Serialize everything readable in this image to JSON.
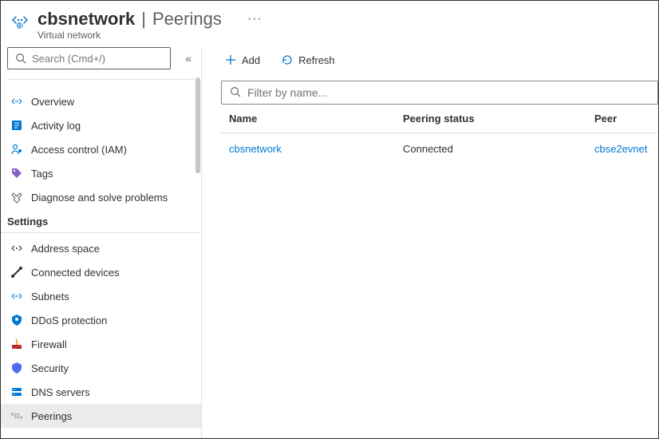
{
  "header": {
    "resource_name": "cbsnetwork",
    "page_name": "Peerings",
    "resource_type": "Virtual network",
    "more_label": "···"
  },
  "sidebar": {
    "search_placeholder": "Search (Cmd+/)",
    "collapse_label": "«",
    "section_settings": "Settings",
    "items": [
      {
        "label": "Overview"
      },
      {
        "label": "Activity log"
      },
      {
        "label": "Access control (IAM)"
      },
      {
        "label": "Tags"
      },
      {
        "label": "Diagnose and solve problems"
      }
    ],
    "settings_items": [
      {
        "label": "Address space"
      },
      {
        "label": "Connected devices"
      },
      {
        "label": "Subnets"
      },
      {
        "label": "DDoS protection"
      },
      {
        "label": "Firewall"
      },
      {
        "label": "Security"
      },
      {
        "label": "DNS servers"
      },
      {
        "label": "Peerings"
      }
    ]
  },
  "toolbar": {
    "add_label": "Add",
    "refresh_label": "Refresh"
  },
  "filter": {
    "placeholder": "Filter by name..."
  },
  "table": {
    "columns": {
      "name": "Name",
      "status": "Peering status",
      "peer": "Peer"
    },
    "rows": [
      {
        "name": "cbsnetwork",
        "status": "Connected",
        "peer": "cbse2evnet"
      }
    ]
  }
}
